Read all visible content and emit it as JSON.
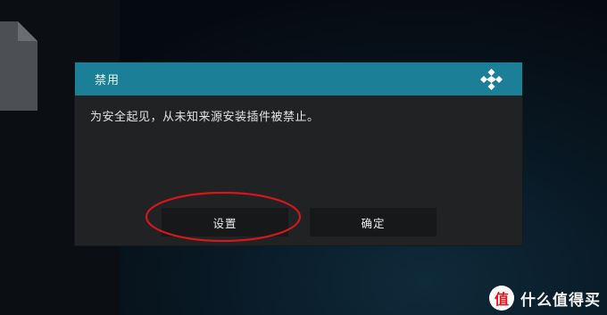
{
  "dialog": {
    "title": "禁用",
    "message": "为安全起见，从未知来源安装插件被禁止。",
    "buttons": {
      "settings": "设置",
      "ok": "确定"
    }
  },
  "icons": {
    "logo": "kodi-logo-icon",
    "file": "file-icon"
  },
  "colors": {
    "header": "#1b7f97",
    "dialog_bg": "#202224",
    "button_bg": "#161819",
    "annotation": "#d4161d"
  },
  "watermark": {
    "badge": "值",
    "text": "什么值得买"
  }
}
